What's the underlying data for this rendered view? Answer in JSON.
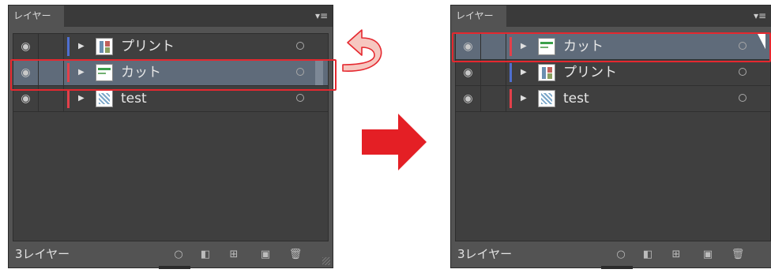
{
  "colors": {
    "layer_print": "#4f6fd0",
    "layer_cut": "#e3404a",
    "layer_test": "#e3404a",
    "highlight": "#e5282f",
    "arrow": "#e41f25"
  },
  "left_panel": {
    "tab_label": "レイヤー",
    "menu_icon": "panel-menu-icon",
    "layers": [
      {
        "name": "プリント",
        "selected": false,
        "color_key": "layer_print"
      },
      {
        "name": "カット",
        "selected": true,
        "color_key": "layer_cut"
      },
      {
        "name": "test",
        "selected": false,
        "color_key": "layer_test"
      }
    ],
    "footer_count": "3レイヤー"
  },
  "right_panel": {
    "tab_label": "レイヤー",
    "menu_icon": "panel-menu-icon",
    "layers": [
      {
        "name": "カット",
        "selected": true,
        "color_key": "layer_cut"
      },
      {
        "name": "プリント",
        "selected": false,
        "color_key": "layer_print"
      },
      {
        "name": "test",
        "selected": false,
        "color_key": "layer_test"
      }
    ],
    "footer_count": "3レイヤー"
  }
}
